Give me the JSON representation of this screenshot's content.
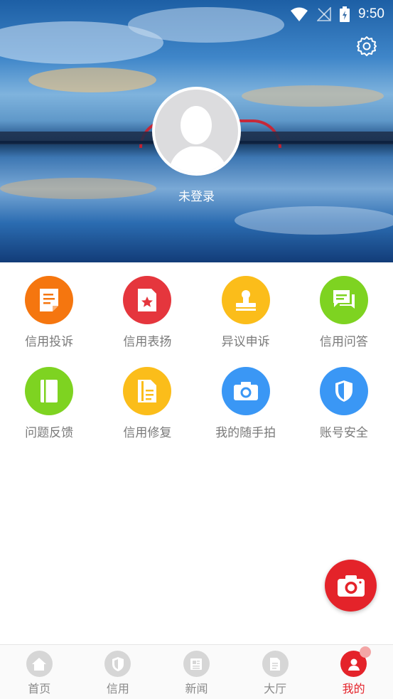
{
  "status_bar": {
    "time": "9:50"
  },
  "profile": {
    "login_text": "未登录"
  },
  "colors": {
    "accent": "#e4232a",
    "orange": "#f5760f",
    "red": "#e5363d",
    "yellow": "#fbbd1a",
    "green": "#7ed321",
    "blue": "#3a97f5"
  },
  "menu": [
    {
      "label": "信用投诉",
      "icon": "complaint-doc-icon",
      "color": "#f5760f"
    },
    {
      "label": "信用表扬",
      "icon": "praise-star-icon",
      "color": "#e5363d"
    },
    {
      "label": "异议申诉",
      "icon": "stamp-icon",
      "color": "#fbbd1a"
    },
    {
      "label": "信用问答",
      "icon": "chat-bubble-icon",
      "color": "#7ed321"
    },
    {
      "label": "问题反馈",
      "icon": "book-icon",
      "color": "#7ed321"
    },
    {
      "label": "信用修复",
      "icon": "repair-doc-icon",
      "color": "#fbbd1a"
    },
    {
      "label": "我的随手拍",
      "icon": "camera-icon",
      "color": "#3a97f5"
    },
    {
      "label": "账号安全",
      "icon": "shield-icon",
      "color": "#3a97f5"
    }
  ],
  "nav": [
    {
      "label": "首页",
      "icon": "home-icon"
    },
    {
      "label": "信用",
      "icon": "shield-icon"
    },
    {
      "label": "新闻",
      "icon": "news-icon"
    },
    {
      "label": "大厅",
      "icon": "hall-doc-icon"
    },
    {
      "label": "我的",
      "icon": "user-icon",
      "active": true
    }
  ]
}
